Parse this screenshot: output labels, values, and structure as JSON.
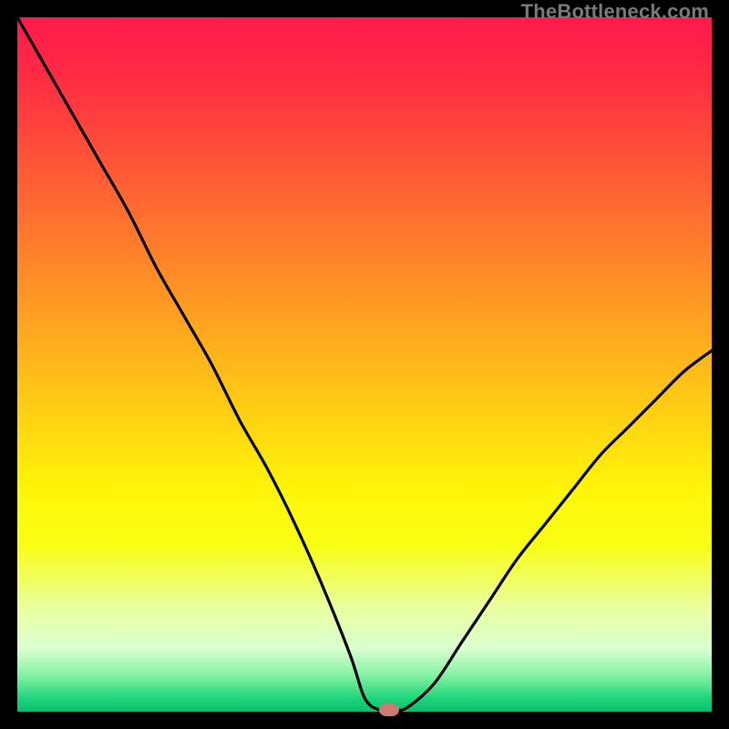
{
  "watermark": "TheBottleneck.com",
  "colors": {
    "frame": "#000000",
    "curve": "#000000",
    "marker": "#c97c6f"
  },
  "chart_data": {
    "type": "line",
    "title": "",
    "xlabel": "",
    "ylabel": "",
    "xlim": [
      0,
      100
    ],
    "ylim": [
      0,
      100
    ],
    "grid": false,
    "series": [
      {
        "name": "bottleneck-curve",
        "x": [
          0,
          4,
          8,
          12,
          16,
          20,
          24,
          28,
          32,
          36,
          40,
          44,
          48,
          50,
          52,
          54,
          56,
          60,
          64,
          68,
          72,
          76,
          80,
          84,
          88,
          92,
          96,
          100
        ],
        "y": [
          100,
          93,
          86,
          79,
          72,
          64,
          57,
          50,
          42,
          35,
          27,
          18,
          8,
          2,
          0.3,
          0.3,
          0.5,
          4,
          10,
          16,
          22,
          27,
          32,
          37,
          41,
          45,
          49,
          52
        ]
      }
    ],
    "marker": {
      "x": 53.5,
      "y": 0.3
    },
    "background_gradient": [
      {
        "stop": 0,
        "color": "#ff1a4a"
      },
      {
        "stop": 50,
        "color": "#ffb11c"
      },
      {
        "stop": 75,
        "color": "#fff508"
      },
      {
        "stop": 95,
        "color": "#7ef0a0"
      },
      {
        "stop": 100,
        "color": "#0bbd6e"
      }
    ]
  }
}
